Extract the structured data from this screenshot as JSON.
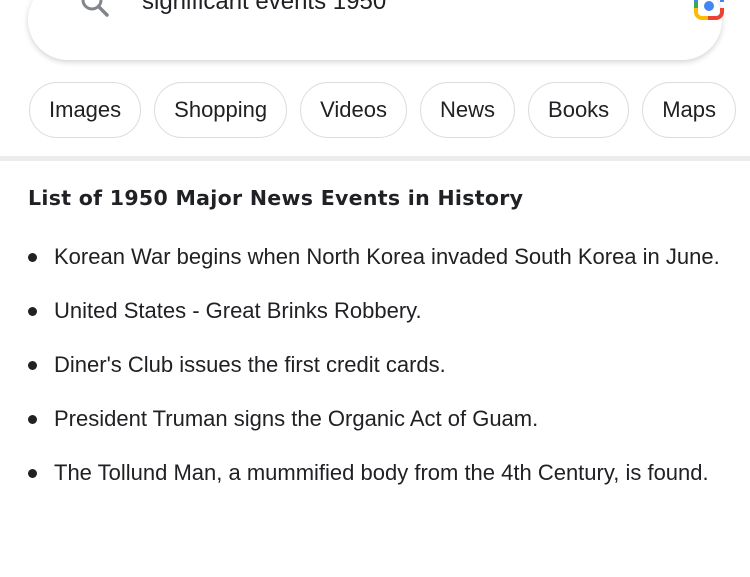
{
  "search": {
    "query": "significant events 1950",
    "search_icon": "search-icon",
    "lens_icon": "google-lens-icon"
  },
  "chips": [
    "Images",
    "Shopping",
    "Videos",
    "News",
    "Books",
    "Maps"
  ],
  "result": {
    "title": "List of 1950 Major News Events in History",
    "items": [
      "Korean War begins when North Korea invaded South Korea in June.",
      "United States - Great Brinks Robbery.",
      "Diner's Club issues the first credit cards.",
      "President Truman signs the Organic Act of Guam.",
      "The Tollund Man, a mummified body from the 4th Century, is found."
    ]
  }
}
